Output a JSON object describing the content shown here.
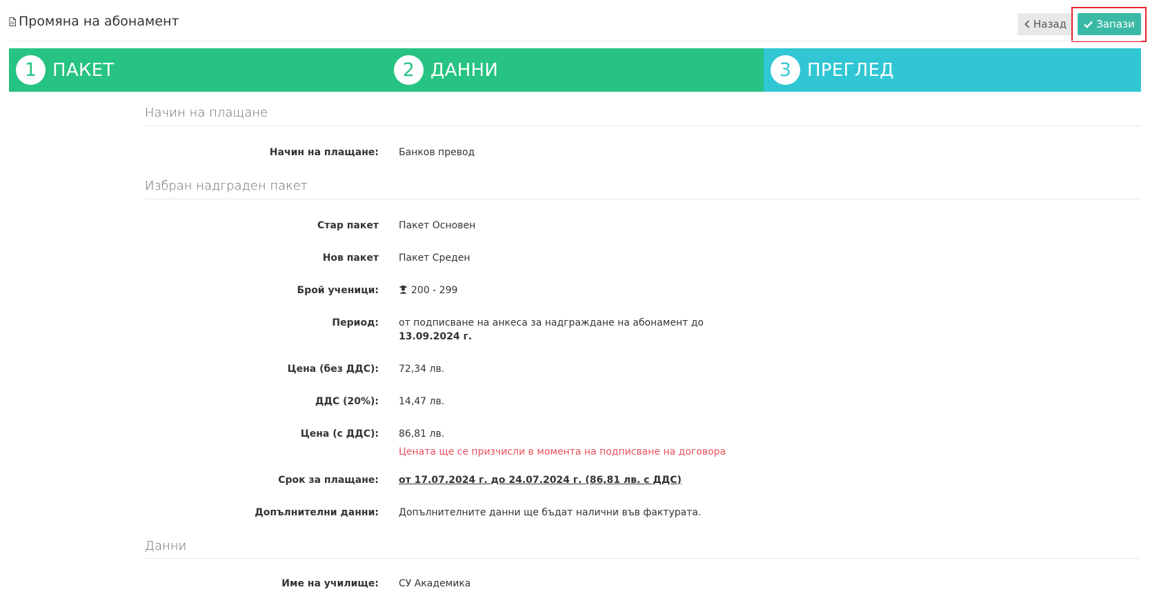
{
  "header": {
    "title": "Промяна на абонамент",
    "back_label": "Назад",
    "save_label": "Запази"
  },
  "steps": [
    {
      "number": "1",
      "label": "ПАКЕТ"
    },
    {
      "number": "2",
      "label": "ДАННИ"
    },
    {
      "number": "3",
      "label": "ПРЕГЛЕД"
    }
  ],
  "colors": {
    "step_done": "#27c383",
    "step_active": "#31c6d3",
    "save_button": "#3bb9a7",
    "highlight": "#e8222c",
    "note": "#e8505b"
  },
  "payment": {
    "section_title": "Начин на плащане",
    "method_label": "Начин на плащане:",
    "method_value": "Банков превод"
  },
  "package": {
    "section_title": "Избран надграден пакет",
    "old_label": "Стар пакет",
    "old_value": "Пакет Основен",
    "new_label": "Нов пакет",
    "new_value": "Пакет Среден",
    "students_label": "Брой ученици:",
    "students_icon": "graduate-icon",
    "students_value": "200 - 299",
    "period_label": "Период:",
    "period_text": "от подписване на анкеса за надграждане на абонамент до",
    "period_date": "13.09.2024 г.",
    "price_net_label": "Цена (без ДДС):",
    "price_net_value": "72,34 лв.",
    "vat_label": "ДДС (20%):",
    "vat_value": "14,47 лв.",
    "price_gross_label": "Цена (с ДДС):",
    "price_gross_value": "86,81 лв.",
    "price_note": "Цената ще се призчисли в момента на подписване на договора",
    "due_label": "Срок за плащане:",
    "due_value": "от 17.07.2024 г. до 24.07.2024 г. (86,81 лв. с ДДС)",
    "extra_label": "Допълнителни данни:",
    "extra_value": "Допълнителните данни ще бъдат налични във фактурата."
  },
  "data_section": {
    "section_title": "Данни",
    "school_label": "Име на училище:",
    "school_value": "СУ Академика"
  }
}
